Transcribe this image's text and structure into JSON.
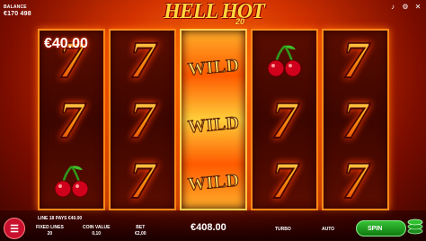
{
  "balance": {
    "label": "BALANCE",
    "value": "€170 498"
  },
  "logo": {
    "title": "HELL HOT",
    "number": "20"
  },
  "reels": {
    "win_amount": "€40.00",
    "wild_label": "WILD",
    "columns": [
      [
        "seven",
        "seven",
        "cherry"
      ],
      [
        "seven",
        "seven",
        "seven"
      ],
      [
        "wild",
        "wild",
        "wild"
      ],
      [
        "cherry",
        "seven",
        "seven"
      ],
      [
        "seven",
        "seven",
        "seven"
      ]
    ]
  },
  "bottom_bar": {
    "line_info": "LINE 18 PAYS €40.00",
    "fixed_lines": {
      "label": "FIXED LINES",
      "value": "20"
    },
    "coin_value": {
      "label": "COIN VALUE",
      "value": "0,10"
    },
    "bet": {
      "label": "BET",
      "value": "€2,00"
    },
    "total_win": "€408.00",
    "turbo_label": "TURBO",
    "auto_label": "AUTO",
    "spin_label": "SPIN"
  }
}
